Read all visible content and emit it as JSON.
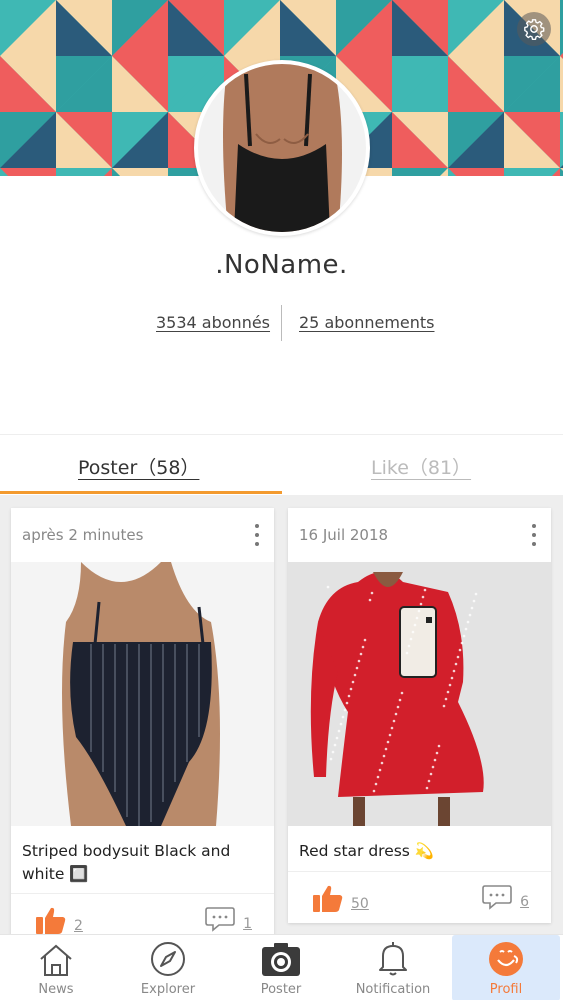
{
  "profile": {
    "username": ".NoName.",
    "followers": "3534 abonnés",
    "following": "25 abonnements"
  },
  "tabs": {
    "posts": "Poster（58）",
    "likes": "Like（81）"
  },
  "posts": [
    {
      "date": "après 2 minutes",
      "caption": "Striped bodysuit Black and white 🔲",
      "likes": "2",
      "comments": "1"
    },
    {
      "date": "16 Juil 2018",
      "caption": "Red star dress 💫",
      "likes": "50",
      "comments": "6"
    }
  ],
  "nav": {
    "items": [
      {
        "label": "News",
        "icon": "home-icon"
      },
      {
        "label": "Explorer",
        "icon": "compass-icon"
      },
      {
        "label": "Poster",
        "icon": "camera-icon"
      },
      {
        "label": "Notification",
        "icon": "bell-icon"
      },
      {
        "label": "Profil",
        "icon": "profile-face-icon"
      }
    ]
  },
  "colors": {
    "accent": "#f39a2e",
    "like": "#f47a3a",
    "banner_teal": "#3fb8b4",
    "banner_navy": "#2b5b7b",
    "banner_red": "#ef5d5d",
    "banner_cream": "#f6d8aa"
  }
}
